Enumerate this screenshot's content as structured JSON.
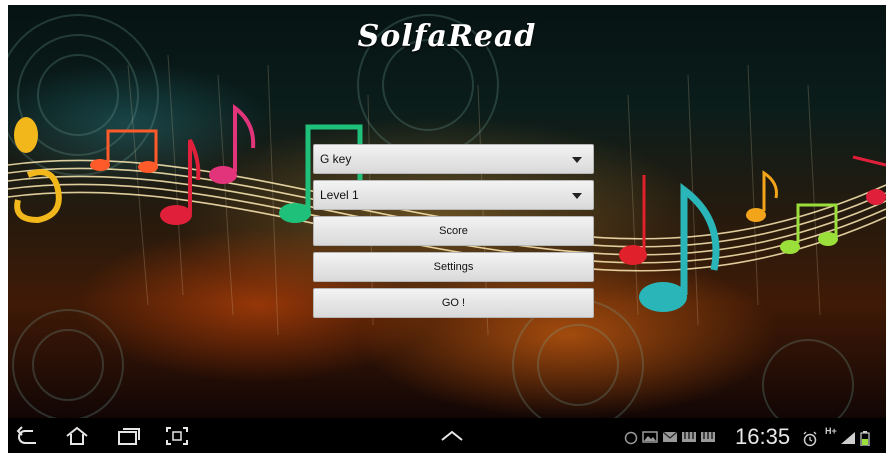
{
  "app": {
    "title": "SolfaRead"
  },
  "form": {
    "key_select": {
      "value": "G key"
    },
    "level_select": {
      "value": "Level 1"
    },
    "score_button": "Score",
    "settings_button": "Settings",
    "go_button": "GO !"
  },
  "statusbar": {
    "time": "16:35",
    "network_label": "H+"
  },
  "colors": {
    "button_face": "#e6e6e6",
    "title_text": "#ffffff",
    "navbar_bg": "#000000"
  }
}
